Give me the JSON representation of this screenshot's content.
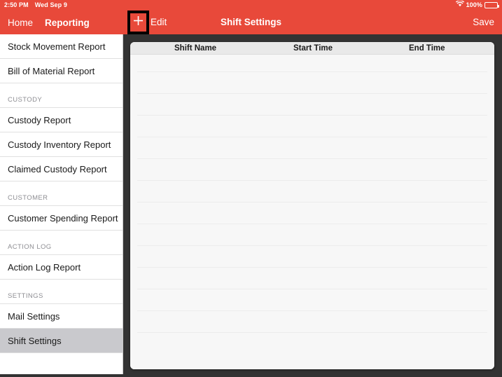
{
  "status_bar": {
    "time": "2:50 PM",
    "date": "Wed Sep 9",
    "wifi_icon": "wifi-icon",
    "battery_percent": "100%",
    "battery_icon": "battery-full-icon"
  },
  "nav_bar": {
    "back_label": "Home",
    "section_label": "Reporting",
    "add_icon": "plus-icon",
    "edit_label": "Edit",
    "title": "Shift Settings",
    "save_label": "Save",
    "background_color": "#E8493A",
    "highlight_box_color": "#000000"
  },
  "sidebar": {
    "selected_item": "Shift Settings",
    "selected_background": "#c9c9cd",
    "items": [
      {
        "type": "item",
        "label": "Stock Movement Report"
      },
      {
        "type": "item",
        "label": "Bill of Material Report"
      },
      {
        "type": "section",
        "label": "CUSTODY"
      },
      {
        "type": "item",
        "label": "Custody Report"
      },
      {
        "type": "item",
        "label": "Custody Inventory Report"
      },
      {
        "type": "item",
        "label": "Claimed Custody Report"
      },
      {
        "type": "section",
        "label": "CUSTOMER"
      },
      {
        "type": "item",
        "label": "Customer Spending Report"
      },
      {
        "type": "section",
        "label": "ACTION LOG"
      },
      {
        "type": "item",
        "label": "Action Log Report"
      },
      {
        "type": "section",
        "label": "SETTINGS"
      },
      {
        "type": "item",
        "label": "Mail Settings"
      },
      {
        "type": "item",
        "label": "Shift Settings",
        "selected": true
      }
    ]
  },
  "main": {
    "table": {
      "columns": [
        "Shift Name",
        "Start Time",
        "End Time"
      ],
      "rows": [],
      "empty_row_count": 14
    },
    "background_color": "#333333",
    "panel_color": "#f7f7f7"
  }
}
